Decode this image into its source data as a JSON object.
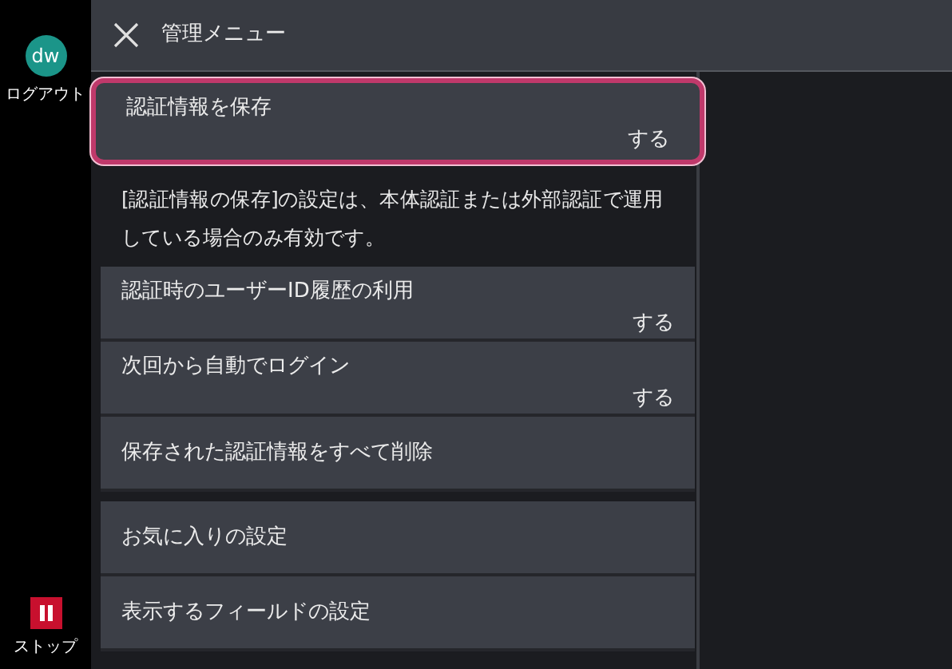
{
  "sidebar": {
    "avatar": "dw",
    "logout_label": "ログアウト",
    "stop_label": "ストップ"
  },
  "header": {
    "title": "管理メニュー"
  },
  "items": [
    {
      "kind": "setting",
      "label": "認証情報を保存",
      "value": "する",
      "selected": true
    },
    {
      "kind": "note",
      "text": "[認証情報の保存]の設定は、本体認証または外部認証で運用している場合のみ有効です。"
    },
    {
      "kind": "setting",
      "label": "認証時のユーザーID履歴の利用",
      "value": "する",
      "selected": false
    },
    {
      "kind": "setting",
      "label": "次回から自動でログイン",
      "value": "する",
      "selected": false
    },
    {
      "kind": "action",
      "label": "保存された認証情報をすべて削除",
      "selected": false
    },
    {
      "kind": "gap"
    },
    {
      "kind": "action",
      "label": "お気に入りの設定",
      "selected": false
    },
    {
      "kind": "action",
      "label": "表示するフィールドの設定",
      "selected": false
    }
  ]
}
